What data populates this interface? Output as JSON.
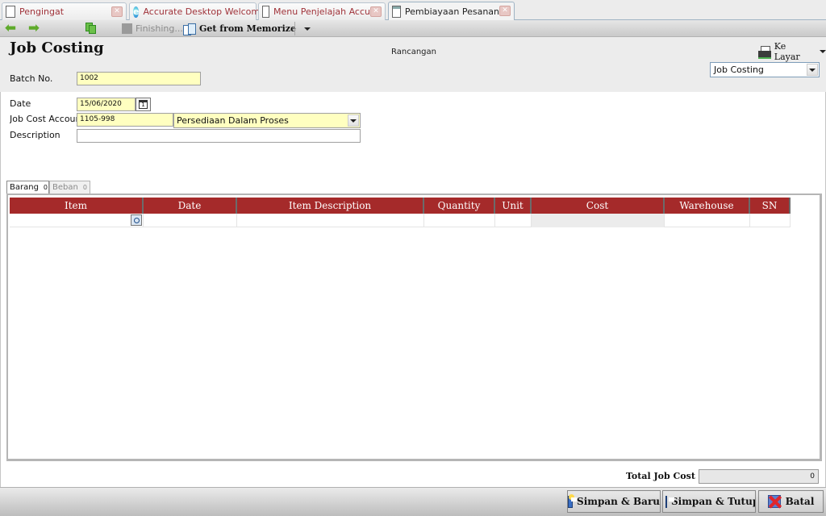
{
  "tabs": [
    {
      "label": "Pengingat",
      "icon": "document-icon",
      "active": false
    },
    {
      "label": "Accurate Desktop Welcome...",
      "icon": "browser-icon",
      "active": false
    },
    {
      "label": "Menu Penjelajah Accur...",
      "icon": "document-icon",
      "active": false
    },
    {
      "label": "Pembiayaan Pesanan ...",
      "icon": "calendar-document-icon",
      "active": true
    }
  ],
  "toolbar": {
    "back_icon": "arrow-left-icon",
    "forward_icon": "arrow-right-icon",
    "copy_icon": "copy-icon",
    "finishing_label": "Finishing...",
    "memorize_label": "Get from Memorize"
  },
  "header": {
    "title": "Job Costing",
    "status": "Rancangan",
    "print_label": "Ke Layar",
    "form_template": "Job Costing"
  },
  "form": {
    "batch_no_label": "Batch No.",
    "batch_no_value": "1002",
    "date_label": "Date",
    "date_value": "15/06/2020",
    "account_label": "Job Cost Account",
    "account_code": "1105-998",
    "account_name": "Persediaan Dalam Proses",
    "description_label": "Description",
    "description_value": ""
  },
  "grid_tabs": [
    {
      "label": "Barang",
      "count": "0",
      "active": true
    },
    {
      "label": "Beban",
      "count": "0",
      "active": false
    }
  ],
  "grid": {
    "columns": [
      "Item",
      "Date",
      "Item Description",
      "Quantity",
      "Unit",
      "Cost",
      "Warehouse",
      "SN"
    ],
    "rows": [
      [
        "",
        "",
        "",
        "",
        "",
        "",
        "",
        ""
      ]
    ]
  },
  "total": {
    "label": "Total Job Cost",
    "value": "0"
  },
  "footer": {
    "save_new_label": "Simpan & Baru",
    "save_close_label": "Simpan & Tutup",
    "cancel_label": "Batal"
  },
  "colors": {
    "grid_header": "#a52a2a",
    "required_field": "#ffffc0",
    "tab_label": "#a0333a"
  }
}
